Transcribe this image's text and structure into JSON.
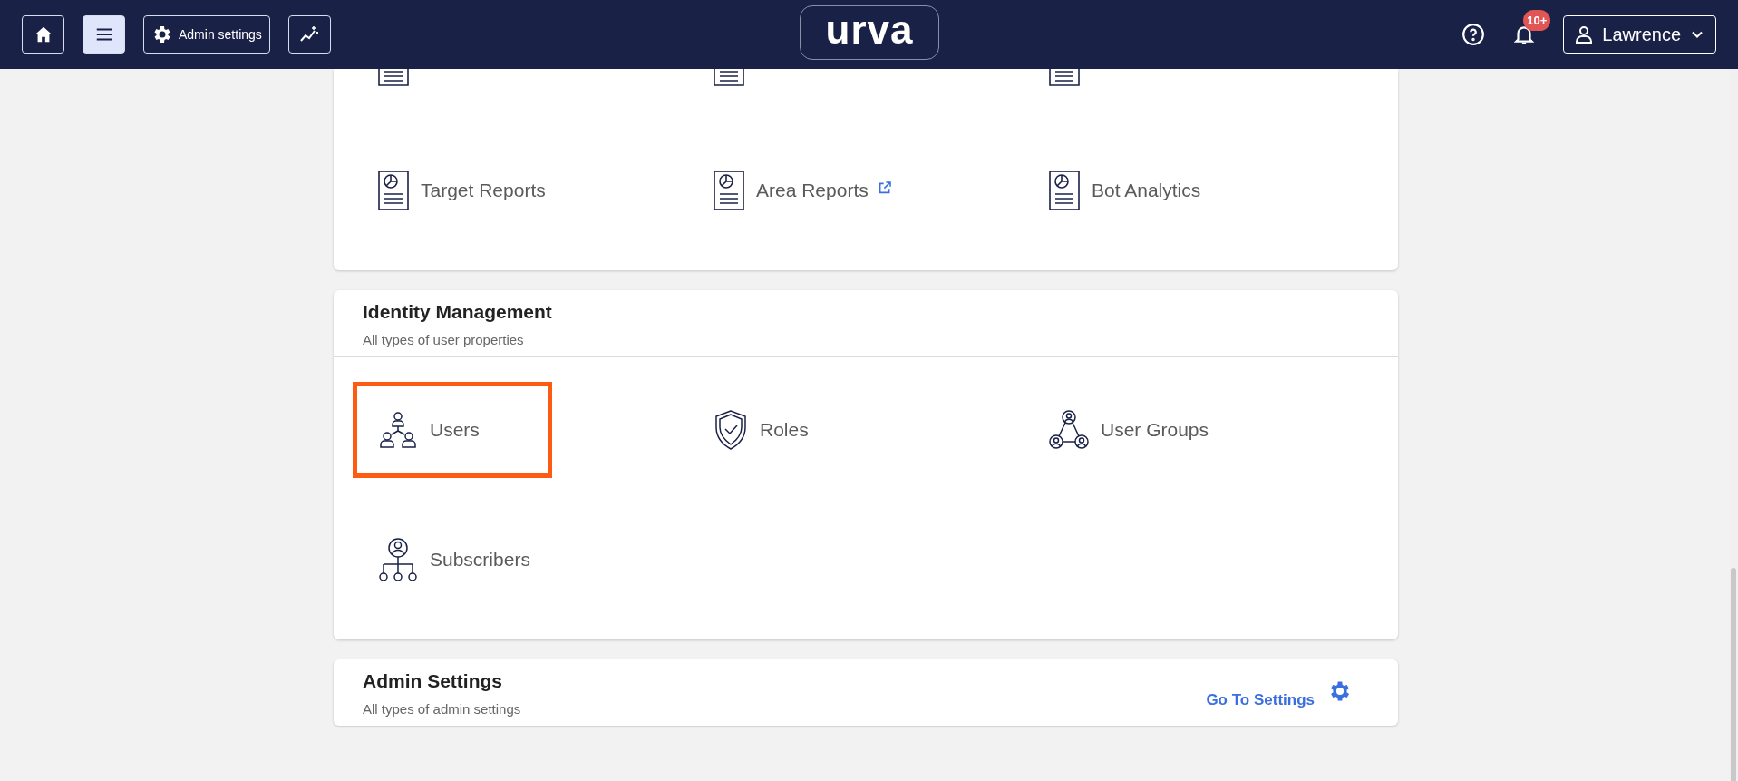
{
  "header": {
    "buttons": [
      {
        "kind": "home",
        "selected": false
      },
      {
        "kind": "menu",
        "selected": true
      },
      {
        "kind": "settings",
        "label": "Admin settings",
        "selected": false
      },
      {
        "kind": "insights",
        "selected": false
      }
    ],
    "logo": "urva",
    "notification_badge": "10+",
    "user": "Lawrence"
  },
  "reports": {
    "items": [
      {
        "kind": "list-doc"
      },
      {
        "kind": "list-doc"
      },
      {
        "kind": "list-doc"
      },
      {
        "kind": "chart-doc",
        "label": "Target Reports",
        "external": false,
        "highlighted": false
      },
      {
        "kind": "chart-doc",
        "label": "Area Reports",
        "external": true,
        "highlighted": false
      },
      {
        "kind": "chart-doc",
        "label": "Bot Analytics",
        "external": false,
        "highlighted": false
      }
    ]
  },
  "identity_management": {
    "title": "Identity Management",
    "subtitle": "All types of user properties",
    "items": [
      {
        "kind": "users",
        "label": "Users",
        "external": false,
        "highlighted": true
      },
      {
        "kind": "shield",
        "label": "Roles",
        "external": false,
        "highlighted": false
      },
      {
        "kind": "user-groups",
        "label": "User Groups",
        "external": false,
        "highlighted": false
      },
      {
        "kind": "subscribers",
        "label": "Subscribers",
        "external": false,
        "highlighted": false
      }
    ]
  },
  "admin_settings": {
    "title": "Admin Settings",
    "subtitle": "All types of admin settings",
    "link": "Go To Settings"
  }
}
